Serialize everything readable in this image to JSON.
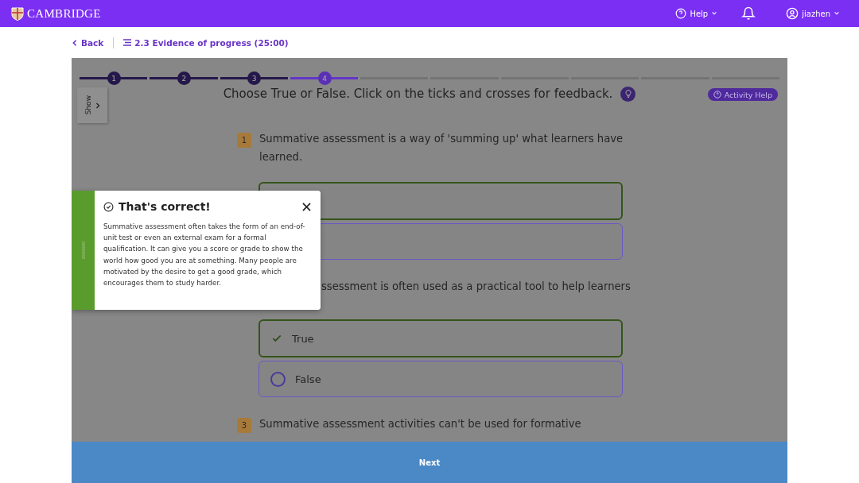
{
  "header": {
    "brand": "CAMBRIDGE",
    "help": "Help",
    "user": "jiazhen"
  },
  "breadcrumb": {
    "back": "Back",
    "title": "2.3 Evidence of progress (25:00)"
  },
  "progress": [
    {
      "label": "1",
      "completed": true,
      "selected": false
    },
    {
      "label": "2",
      "completed": true,
      "selected": false
    },
    {
      "label": "3",
      "completed": true,
      "selected": false
    },
    {
      "label": "4",
      "completed": false,
      "selected": true
    },
    {
      "completed": false,
      "selected": false
    },
    {
      "completed": false,
      "selected": false
    },
    {
      "completed": false,
      "selected": false
    },
    {
      "completed": false,
      "selected": false
    },
    {
      "completed": false,
      "selected": false
    },
    {
      "completed": false,
      "selected": false
    }
  ],
  "show_tab": "Show",
  "instruction": "Choose True or False. Click on the ticks and crosses for feedback.",
  "activity_help": "Activity Help",
  "questions": [
    {
      "number": "1",
      "text": "Summative assessment is a way of 'summing up' what learners have learned.",
      "options": [
        {
          "selected": true
        },
        {
          "selected": false
        }
      ]
    },
    {
      "text": "ssessment is often used as a practical tool to help learners",
      "options": [
        {
          "label": "True",
          "selected": true
        },
        {
          "label": "False",
          "selected": false
        }
      ]
    },
    {
      "number": "3",
      "text": "Summative assessment activities can't be used for formative"
    }
  ],
  "feedback": {
    "title": "That's correct!",
    "body": "Summative assessment often takes the form of an end-of-unit test or even an external exam for a formal qualification. It can give you a score or grade to show the world how good you are at something. Many people are motivated by the desire to get a good grade, which encourages them to study harder."
  },
  "next": "Next"
}
